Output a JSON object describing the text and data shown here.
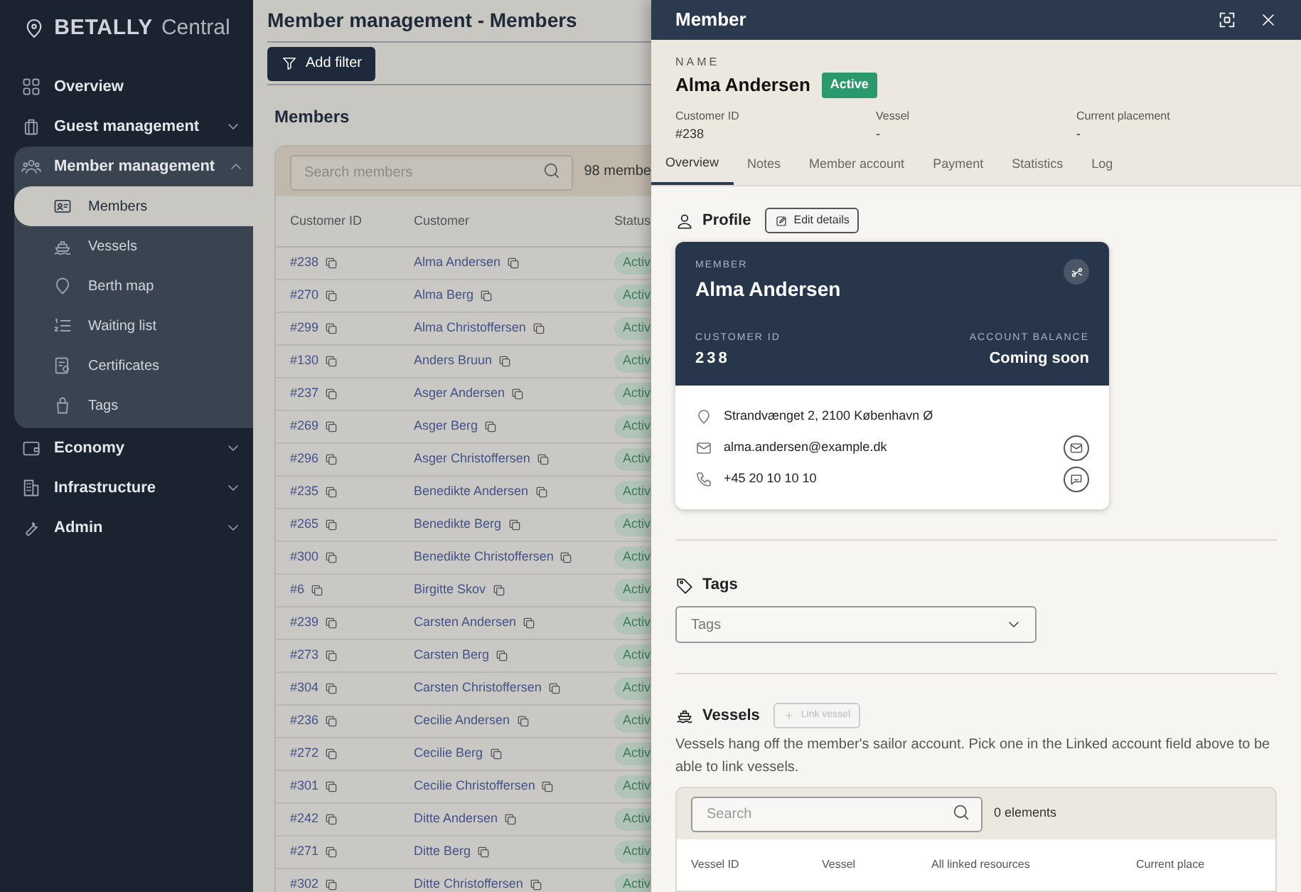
{
  "brand": {
    "name": "BETALLY",
    "suffix": "Central"
  },
  "sidebar": {
    "items": [
      {
        "label": "Overview",
        "selected": false
      },
      {
        "label": "Guest management",
        "selected": false,
        "expanded": false
      },
      {
        "label": "Member management",
        "selected": false,
        "expanded": true,
        "children": [
          {
            "label": "Members",
            "selected": true
          },
          {
            "label": "Vessels",
            "selected": false
          },
          {
            "label": "Berth map",
            "selected": false
          },
          {
            "label": "Waiting list",
            "selected": false
          },
          {
            "label": "Certificates",
            "selected": false
          },
          {
            "label": "Tags",
            "selected": false
          }
        ]
      },
      {
        "label": "Economy",
        "selected": false,
        "expanded": false
      },
      {
        "label": "Infrastructure",
        "selected": false,
        "expanded": false
      },
      {
        "label": "Admin",
        "selected": false,
        "expanded": false
      }
    ]
  },
  "page": {
    "title": "Member management - Members",
    "add_filter": "Add filter",
    "section_title": "Members",
    "search": {
      "placeholder": "Search members"
    },
    "count": "98 membe",
    "columns": [
      "Customer ID",
      "Customer",
      "Status"
    ],
    "rows": [
      {
        "id": "#238",
        "customer": "Alma Andersen",
        "status": "Activ"
      },
      {
        "id": "#270",
        "customer": "Alma Berg",
        "status": "Activ"
      },
      {
        "id": "#299",
        "customer": "Alma Christoffersen",
        "status": "Activ"
      },
      {
        "id": "#130",
        "customer": "Anders Bruun",
        "status": "Activ"
      },
      {
        "id": "#237",
        "customer": "Asger Andersen",
        "status": "Activ"
      },
      {
        "id": "#269",
        "customer": "Asger Berg",
        "status": "Activ"
      },
      {
        "id": "#296",
        "customer": "Asger Christoffersen",
        "status": "Activ"
      },
      {
        "id": "#235",
        "customer": "Benedikte Andersen",
        "status": "Activ"
      },
      {
        "id": "#265",
        "customer": "Benedikte Berg",
        "status": "Activ"
      },
      {
        "id": "#300",
        "customer": "Benedikte Christoffersen",
        "status": "Activ"
      },
      {
        "id": "#6",
        "customer": "Birgitte Skov",
        "status": "Activ"
      },
      {
        "id": "#239",
        "customer": "Carsten Andersen",
        "status": "Activ"
      },
      {
        "id": "#273",
        "customer": "Carsten Berg",
        "status": "Activ"
      },
      {
        "id": "#304",
        "customer": "Carsten Christoffersen",
        "status": "Activ"
      },
      {
        "id": "#236",
        "customer": "Cecilie Andersen",
        "status": "Activ"
      },
      {
        "id": "#272",
        "customer": "Cecilie Berg",
        "status": "Activ"
      },
      {
        "id": "#301",
        "customer": "Cecilie Christoffersen",
        "status": "Activ"
      },
      {
        "id": "#242",
        "customer": "Ditte Andersen",
        "status": "Activ"
      },
      {
        "id": "#271",
        "customer": "Ditte Berg",
        "status": "Activ"
      },
      {
        "id": "#302",
        "customer": "Ditte Christoffersen",
        "status": "Activ"
      }
    ]
  },
  "drawer": {
    "title": "Member",
    "name_label": "NAME",
    "name": "Alma Andersen",
    "status": "Active",
    "fields": [
      {
        "label": "Customer ID",
        "value": "#238"
      },
      {
        "label": "Vessel",
        "value": "-"
      },
      {
        "label": "Current placement",
        "value": "-"
      }
    ],
    "tabs": [
      {
        "label": "Overview",
        "selected": true
      },
      {
        "label": "Notes",
        "selected": false
      },
      {
        "label": "Member account",
        "selected": false
      },
      {
        "label": "Payment",
        "selected": false
      },
      {
        "label": "Statistics",
        "selected": false
      },
      {
        "label": "Log",
        "selected": false
      }
    ],
    "profile": {
      "title": "Profile",
      "edit_button": "Edit details",
      "card": {
        "label": "MEMBER",
        "name": "Alma Andersen",
        "id_label": "CUSTOMER ID",
        "id": "238",
        "balance_label": "ACCOUNT BALANCE",
        "balance": "Coming soon"
      },
      "contacts": [
        {
          "kind": "address",
          "text": "Strandvænget 2, 2100 København Ø"
        },
        {
          "kind": "email",
          "text": "alma.andersen@example.dk"
        },
        {
          "kind": "phone",
          "text": "+45 20 10 10 10"
        }
      ]
    },
    "tags": {
      "title": "Tags",
      "placeholder": "Tags"
    },
    "vessels": {
      "title": "Vessels",
      "link_button": {
        "label": "Link vessel",
        "disabled": true
      },
      "note": "Vessels hang off the member's sailor account. Pick one in the Linked account field above to be able to link vessels.",
      "search": {
        "placeholder": "Search"
      },
      "count": "0 elements",
      "columns": [
        "Vessel ID",
        "Vessel",
        "All linked resources",
        "Current place"
      ]
    }
  }
}
